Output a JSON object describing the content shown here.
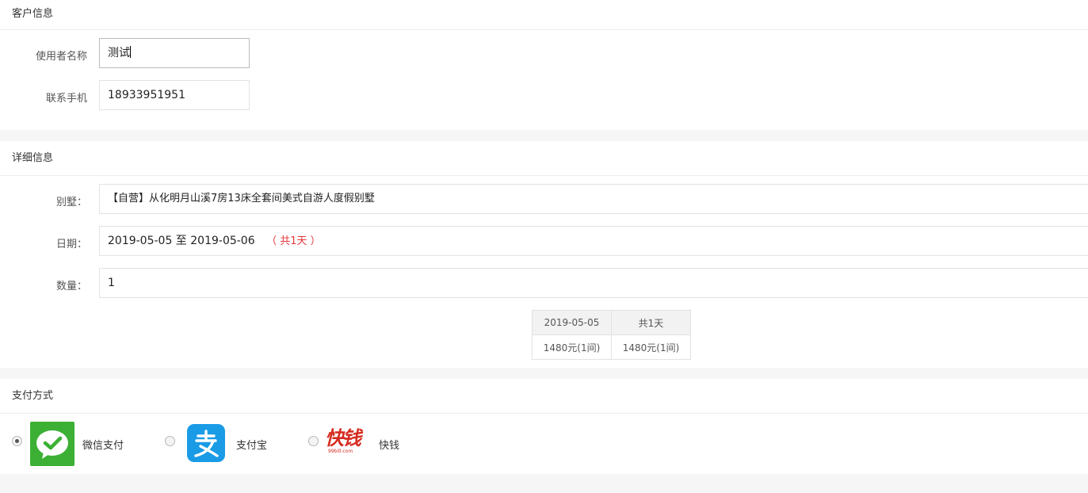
{
  "customer": {
    "title": "客户信息",
    "name_label": "使用者名称",
    "name_value": "测试",
    "phone_label": "联系手机",
    "phone_value": "18933951951"
  },
  "detail": {
    "title": "详细信息",
    "villa_label": "别墅：",
    "villa_value": "【自营】从化明月山溪7房13床全套间美式自游人度假别墅",
    "date_label": "日期：",
    "date_value": "2019-05-05 至 2019-05-06",
    "date_days": "（ 共1天 ）",
    "qty_label": "数量：",
    "qty_value": "1",
    "price_table": {
      "headers": [
        "2019-05-05",
        "共1天"
      ],
      "cells": [
        "1480元(1间)",
        "1480元(1间)"
      ]
    }
  },
  "payment": {
    "title": "支付方式",
    "methods": [
      {
        "label": "微信支付",
        "icon": "wechat-pay-icon",
        "selected": true,
        "color": "#3cb034"
      },
      {
        "label": "支付宝",
        "icon": "alipay-icon",
        "selected": false,
        "color": "#1a9be6"
      },
      {
        "label": "快钱",
        "icon": "kuaiqian-logo",
        "selected": false,
        "color": "#d62b20"
      }
    ],
    "kuaiqian_logo_text": "快钱",
    "kuaiqian_logo_sub": "99bill.com"
  }
}
